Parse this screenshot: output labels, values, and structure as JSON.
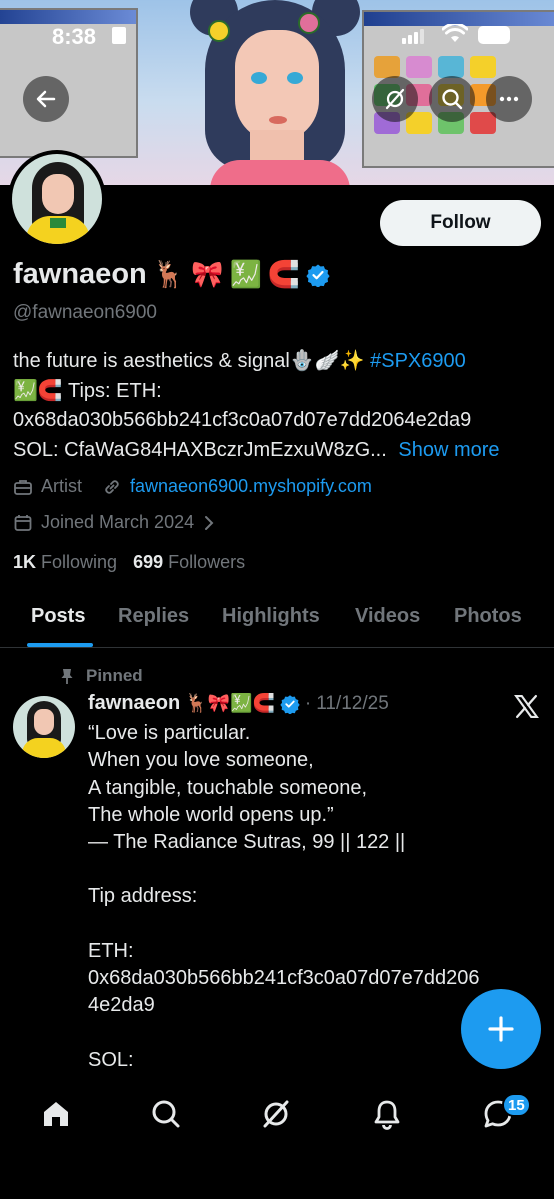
{
  "status_bar": {
    "time": "8:38"
  },
  "profile": {
    "display_name": "fawnaeon",
    "name_emojis": [
      "🦌",
      "🎀",
      "💹",
      "🧲"
    ],
    "handle": "@fawnaeon6900",
    "follow_label": "Follow",
    "bio": {
      "line1_text": "the future is aesthetics & signal",
      "line1_emojis": "🪬🪽✨",
      "hashtag": "#SPX6900",
      "line2_emojis": "💹🧲",
      "line2_text": "Tips: ETH:",
      "line3": "0x68da030b566bb241cf3c0a07d07e7dd2064e2da9",
      "line4": "SOL: CfaWaG84HAXBczrJmEzxuW8zG...",
      "show_more": "Show more"
    },
    "category": "Artist",
    "website": "fawnaeon6900.myshopify.com",
    "joined": "Joined March 2024",
    "following_count": "1K",
    "following_label": "Following",
    "followers_count": "699",
    "followers_label": "Followers"
  },
  "tabs": [
    {
      "label": "Posts",
      "active": true
    },
    {
      "label": "Replies",
      "active": false
    },
    {
      "label": "Highlights",
      "active": false
    },
    {
      "label": "Videos",
      "active": false
    },
    {
      "label": "Photos",
      "active": false
    }
  ],
  "pinned_post": {
    "pinned_label": "Pinned",
    "author": "fawnaeon",
    "author_emojis": "🦌🎀💹🧲",
    "separator": "·",
    "date": "11/12/25",
    "lines": [
      "“Love is particular.",
      "When you love someone,",
      "A tangible, touchable someone,",
      "The whole world opens up.”",
      "— The Radiance Sutras, 99 || 122 ||",
      "",
      "Tip address:",
      "",
      "ETH:",
      "0x68da030b566bb241cf3c0a07d07e7dd206",
      "4e2da9",
      "",
      "SOL:"
    ]
  },
  "bottom_nav": {
    "messages_badge": "15"
  },
  "colors": {
    "accent": "#1d9bf0",
    "background": "#000000",
    "text_primary": "#e7e9ea",
    "text_secondary": "#71767b"
  }
}
